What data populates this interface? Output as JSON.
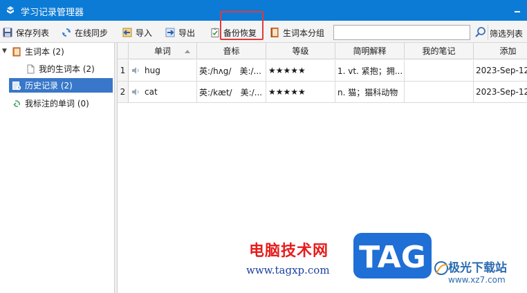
{
  "window": {
    "title": "学习记录管理器"
  },
  "toolbar": {
    "save_list": "保存列表",
    "online_sync": "在线同步",
    "import": "导入",
    "export": "导出",
    "backup_restore": "备份恢复",
    "wordbook_group": "生词本分组",
    "search_value": "",
    "filter_list": "筛选列表"
  },
  "sidebar": {
    "wordbook": "生词本 (2)",
    "my_wordbook": "我的生词本 (2)",
    "history": "历史记录 (2)",
    "marked_words": "我标注的单词 (0)"
  },
  "grid": {
    "headers": [
      "单词",
      "音标",
      "等级",
      "简明解释",
      "我的笔记",
      "添加"
    ],
    "rows": [
      {
        "num": "1",
        "word": "hug",
        "phonetic": "英:/hʌg/　美:/...",
        "level": "★★★★★",
        "definition": "1. vt. 紧抱；拥...",
        "note": "",
        "added": "2023-Sep-12"
      },
      {
        "num": "2",
        "word": "cat",
        "phonetic": "英:/kæt/　美:/...",
        "level": "★★★★★",
        "definition": "n. 猫；猫科动物",
        "note": "",
        "added": "2023-Sep-12"
      }
    ]
  },
  "watermark": {
    "site_cn": "电脑技术网",
    "site_url": "www.tagxp.com",
    "tag": "TAG",
    "site2_name": "极光下载站",
    "site2_url": "www.xz7.com"
  },
  "colors": {
    "titlebar": "#0c7bd6",
    "selection": "#3877c9",
    "highlight_box": "#e23a3a",
    "watermark_red": "#e61c1c",
    "watermark_blue": "#1a3f9e"
  }
}
